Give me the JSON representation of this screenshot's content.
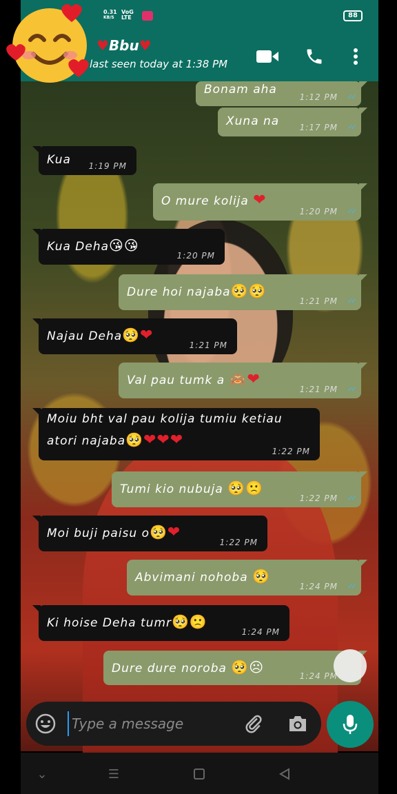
{
  "status": {
    "net_speed": "0.31",
    "net_unit": "KB/S",
    "net_type_1": "VoG",
    "net_type_2": "LTE",
    "battery": "88"
  },
  "header": {
    "contact_name": "Bbu",
    "last_seen": "last seen today at 1:38 PM"
  },
  "messages": [
    {
      "dir": "out",
      "text": "Bonam aha",
      "time": "1:12 PM"
    },
    {
      "dir": "out",
      "text": "Xuna na",
      "time": "1:17 PM"
    },
    {
      "dir": "in",
      "text": "Kua",
      "time": "1:19 PM"
    },
    {
      "dir": "out",
      "text": "O mure kolija",
      "time": "1:20 PM"
    },
    {
      "dir": "in",
      "text": "Kua Deha",
      "time": "1:20 PM"
    },
    {
      "dir": "out",
      "text": "Dure hoi najaba",
      "time": "1:21 PM"
    },
    {
      "dir": "in",
      "text": "Najau Deha",
      "time": "1:21 PM"
    },
    {
      "dir": "out",
      "text": "Val pau tumk a",
      "time": "1:21 PM"
    },
    {
      "dir": "in",
      "text": "Moiu bht val pau kolija tumiu ketiau",
      "text2": "atori najaba",
      "time": "1:22 PM"
    },
    {
      "dir": "out",
      "text": "Tumi kio nubuja",
      "time": "1:22 PM"
    },
    {
      "dir": "in",
      "text": "Moi buji paisu o",
      "time": "1:22 PM"
    },
    {
      "dir": "out",
      "text": "Abvimani nohoba",
      "time": "1:24 PM"
    },
    {
      "dir": "in",
      "text": "Ki hoise Deha tumr",
      "time": "1:24 PM"
    },
    {
      "dir": "out",
      "text": "Dure dure noroba",
      "time": "1:24 PM"
    }
  ],
  "composer": {
    "placeholder": "Type a message"
  },
  "colors": {
    "header": "#0b6e60",
    "outgoing_bubble": "#8a9a6b",
    "incoming_bubble": "#111111",
    "accent": "#0a8f7c"
  }
}
